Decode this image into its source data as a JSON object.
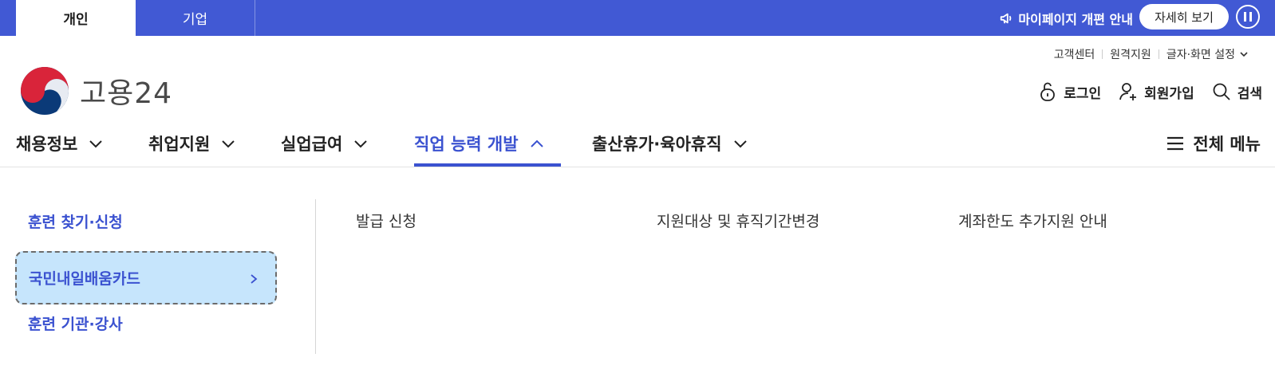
{
  "topbar": {
    "tabs": [
      {
        "label": "개인"
      },
      {
        "label": "기업"
      }
    ],
    "notice": "마이페이지 개편 안내",
    "detail_button": "자세히 보기",
    "colors": {
      "bar": "#4159d4"
    }
  },
  "utility": {
    "links": [
      "고객센터",
      "원격지원",
      "글자·화면 설정"
    ]
  },
  "logo": {
    "text": "고용24"
  },
  "actions": {
    "login": "로그인",
    "signup": "회원가입",
    "search": "검색"
  },
  "gnb": {
    "items": [
      {
        "label": "채용정보"
      },
      {
        "label": "취업지원"
      },
      {
        "label": "실업급여"
      },
      {
        "label": "직업 능력 개발"
      },
      {
        "label": "출산휴가·육아휴직"
      }
    ],
    "active_index": 3,
    "all_menu": "전체 메뉴",
    "accent": "#3b52d0"
  },
  "submenu": {
    "side": [
      {
        "label": "훈련 찾기·신청"
      },
      {
        "label": "국민내일배움카드"
      },
      {
        "label": "훈련 기관·강사"
      }
    ],
    "links": [
      "발급 신청",
      "지원대상 및 휴직기간변경",
      "계좌한도 추가지원 안내"
    ]
  }
}
